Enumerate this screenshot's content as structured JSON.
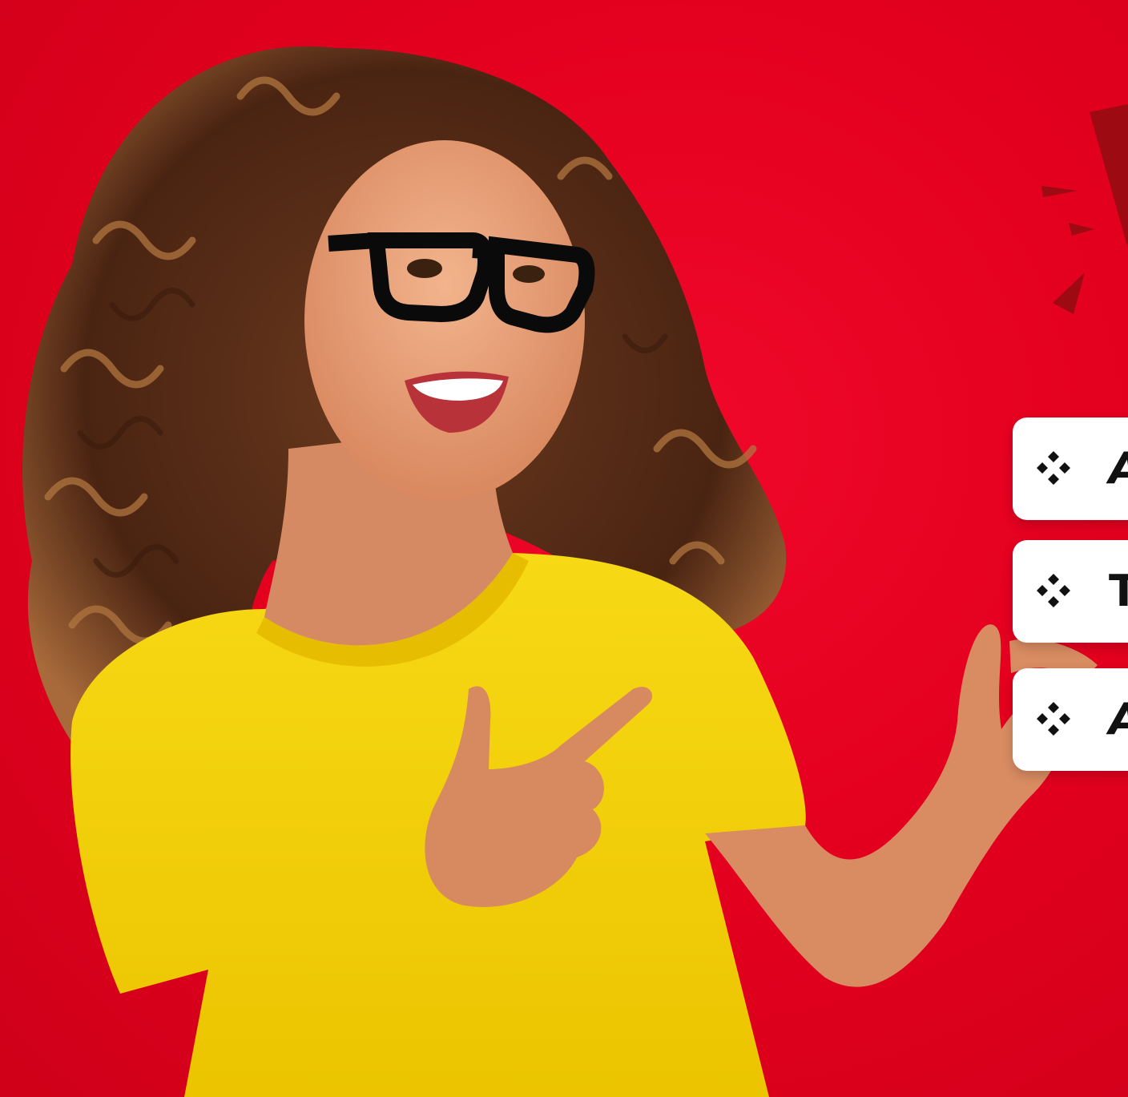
{
  "scene": {
    "background_color": "#e4001f",
    "shirt_color": "#f5d20a",
    "accent_dark_red": "#9e0a12"
  },
  "cards": [
    {
      "text": "A",
      "icon": "four-diamond-bullet-icon"
    },
    {
      "text": "T",
      "icon": "four-diamond-bullet-icon"
    },
    {
      "text": "A",
      "icon": "four-diamond-bullet-icon"
    }
  ]
}
